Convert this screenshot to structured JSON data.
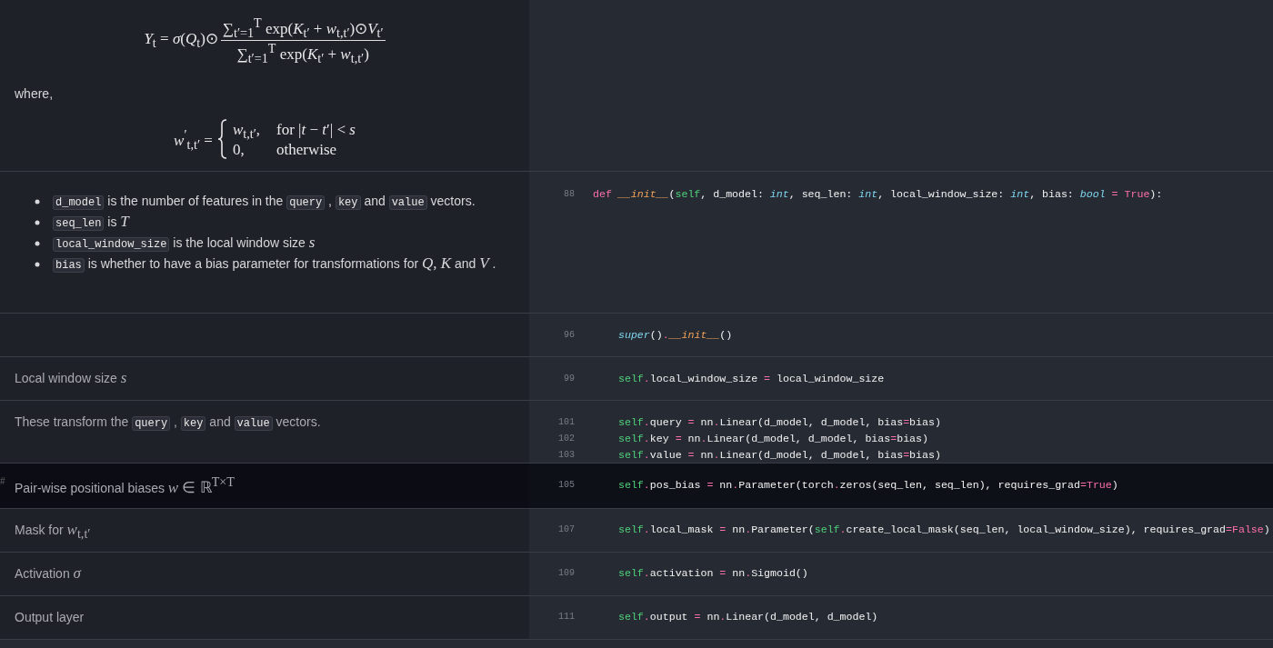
{
  "sections": [
    {
      "selected": false,
      "doc": [
        {
          "kind": "fraction",
          "lhs": "*Y*$_{t}$ = *σ*(*Q*$_{t}$)⊙",
          "numerator": "∑$_{t′=1}$$^{T}$ exp(*K*$_{t′}$ + *w*$_{t,t′}$)⊙*V*$_{t′}$",
          "denominator": "∑$_{t′=1}$$^{T}$ exp(*K*$_{t′}$ + *w*$_{t,t′}$)"
        },
        {
          "kind": "para",
          "segments": [
            {
              "kind": "text",
              "text": "where,"
            }
          ]
        },
        {
          "kind": "cases",
          "lhs": "*w*$^{′}$$_{t,t′}$ =",
          "cases": [
            {
              "value": "*w*$_{t,t′}$,",
              "condition": "for |*t* − *t*′| < *s*"
            },
            {
              "value": "0,",
              "condition": "otherwise"
            }
          ]
        }
      ]
    },
    {
      "selected": false,
      "doc": [
        {
          "kind": "bullets",
          "items": [
            [
              {
                "kind": "code",
                "text": "d_model"
              },
              {
                "kind": "text",
                "text": " is the number of features in the "
              },
              {
                "kind": "code",
                "text": "query"
              },
              {
                "kind": "text",
                "text": " , "
              },
              {
                "kind": "code",
                "text": "key"
              },
              {
                "kind": "text",
                "text": " and "
              },
              {
                "kind": "code",
                "text": "value"
              },
              {
                "kind": "text",
                "text": " vectors."
              }
            ],
            [
              {
                "kind": "code",
                "text": "seq_len"
              },
              {
                "kind": "text",
                "text": " is "
              },
              {
                "kind": "math",
                "text": "*T*"
              }
            ],
            [
              {
                "kind": "code",
                "text": "local_window_size"
              },
              {
                "kind": "text",
                "text": " is the local window size "
              },
              {
                "kind": "math",
                "text": "*s*"
              }
            ],
            [
              {
                "kind": "code",
                "text": "bias"
              },
              {
                "kind": "text",
                "text": " is whether to have a bias parameter for transformations for "
              },
              {
                "kind": "math",
                "text": "*Q*, *K*"
              },
              {
                "kind": "text",
                "text": " and "
              },
              {
                "kind": "math",
                "text": "*V*"
              },
              {
                "kind": "text",
                "text": " ."
              }
            ]
          ]
        }
      ],
      "code": [
        {
          "number": "88",
          "indented": false,
          "tokens": [
            {
              "kind": "kw",
              "text": "def "
            },
            {
              "kind": "fn",
              "text": "__init__"
            },
            {
              "kind": "pl",
              "text": "("
            },
            {
              "kind": "self",
              "text": "self"
            },
            {
              "kind": "pl",
              "text": ", d_model: "
            },
            {
              "kind": "type",
              "text": "int"
            },
            {
              "kind": "pl",
              "text": ", seq_len: "
            },
            {
              "kind": "type",
              "text": "int"
            },
            {
              "kind": "pl",
              "text": ", local_window_size: "
            },
            {
              "kind": "type",
              "text": "int"
            },
            {
              "kind": "pl",
              "text": ", bias: "
            },
            {
              "kind": "type",
              "text": "bool"
            },
            {
              "kind": "op",
              "text": " = "
            },
            {
              "kind": "const",
              "text": "True"
            },
            {
              "kind": "pl",
              "text": "):"
            }
          ]
        }
      ]
    },
    {
      "selected": false,
      "code": [
        {
          "number": "96",
          "indented": true,
          "tokens": [
            {
              "kind": "type",
              "text": "super"
            },
            {
              "kind": "pl",
              "text": "()"
            },
            {
              "kind": "op",
              "text": "."
            },
            {
              "kind": "fn",
              "text": "__init__"
            },
            {
              "kind": "pl",
              "text": "()"
            }
          ]
        }
      ]
    },
    {
      "selected": false,
      "doc": [
        {
          "kind": "para",
          "segments": [
            {
              "kind": "text",
              "text": "Local window size "
            },
            {
              "kind": "math",
              "text": "*s*"
            }
          ]
        }
      ],
      "code": [
        {
          "number": "99",
          "indented": true,
          "tokens": [
            {
              "kind": "self",
              "text": "self"
            },
            {
              "kind": "op",
              "text": "."
            },
            {
              "kind": "pl",
              "text": "local_window_size"
            },
            {
              "kind": "op",
              "text": " = "
            },
            {
              "kind": "pl",
              "text": "local_window_size"
            }
          ]
        }
      ]
    },
    {
      "selected": false,
      "doc": [
        {
          "kind": "para",
          "segments": [
            {
              "kind": "text",
              "text": "These transform the "
            },
            {
              "kind": "code",
              "text": "query"
            },
            {
              "kind": "text",
              "text": " , "
            },
            {
              "kind": "code",
              "text": "key"
            },
            {
              "kind": "text",
              "text": " and "
            },
            {
              "kind": "code",
              "text": "value"
            },
            {
              "kind": "text",
              "text": " vectors."
            }
          ]
        }
      ],
      "code": [
        {
          "number": "101",
          "indented": true,
          "tokens": [
            {
              "kind": "self",
              "text": "self"
            },
            {
              "kind": "op",
              "text": "."
            },
            {
              "kind": "pl",
              "text": "query"
            },
            {
              "kind": "op",
              "text": " = "
            },
            {
              "kind": "pl",
              "text": "nn"
            },
            {
              "kind": "op",
              "text": "."
            },
            {
              "kind": "pl",
              "text": "Linear(d_model, d_model, bias"
            },
            {
              "kind": "op",
              "text": "="
            },
            {
              "kind": "pl",
              "text": "bias)"
            }
          ]
        },
        {
          "number": "102",
          "indented": true,
          "tokens": [
            {
              "kind": "self",
              "text": "self"
            },
            {
              "kind": "op",
              "text": "."
            },
            {
              "kind": "pl",
              "text": "key"
            },
            {
              "kind": "op",
              "text": " = "
            },
            {
              "kind": "pl",
              "text": "nn"
            },
            {
              "kind": "op",
              "text": "."
            },
            {
              "kind": "pl",
              "text": "Linear(d_model, d_model, bias"
            },
            {
              "kind": "op",
              "text": "="
            },
            {
              "kind": "pl",
              "text": "bias)"
            }
          ]
        },
        {
          "number": "103",
          "indented": true,
          "tokens": [
            {
              "kind": "self",
              "text": "self"
            },
            {
              "kind": "op",
              "text": "."
            },
            {
              "kind": "pl",
              "text": "value"
            },
            {
              "kind": "op",
              "text": " = "
            },
            {
              "kind": "pl",
              "text": "nn"
            },
            {
              "kind": "op",
              "text": "."
            },
            {
              "kind": "pl",
              "text": "Linear(d_model, d_model, bias"
            },
            {
              "kind": "op",
              "text": "="
            },
            {
              "kind": "pl",
              "text": "bias)"
            }
          ]
        }
      ]
    },
    {
      "selected": true,
      "anchor": "#",
      "doc": [
        {
          "kind": "para",
          "segments": [
            {
              "kind": "text",
              "text": "Pair-wise positional biases "
            },
            {
              "kind": "math",
              "text": "*w* ∈ ℝ$^{T×T}$"
            }
          ]
        }
      ],
      "code": [
        {
          "number": "105",
          "indented": true,
          "tokens": [
            {
              "kind": "self",
              "text": "self"
            },
            {
              "kind": "op",
              "text": "."
            },
            {
              "kind": "pl",
              "text": "pos_bias"
            },
            {
              "kind": "op",
              "text": " = "
            },
            {
              "kind": "pl",
              "text": "nn"
            },
            {
              "kind": "op",
              "text": "."
            },
            {
              "kind": "pl",
              "text": "Parameter(torch"
            },
            {
              "kind": "op",
              "text": "."
            },
            {
              "kind": "pl",
              "text": "zeros(seq_len, seq_len), requires_grad"
            },
            {
              "kind": "op",
              "text": "="
            },
            {
              "kind": "const",
              "text": "True"
            },
            {
              "kind": "pl",
              "text": ")"
            }
          ]
        }
      ]
    },
    {
      "selected": false,
      "doc": [
        {
          "kind": "para",
          "segments": [
            {
              "kind": "text",
              "text": "Mask for "
            },
            {
              "kind": "math",
              "text": "*w*$_{t,t′}$"
            }
          ]
        }
      ],
      "code": [
        {
          "number": "107",
          "indented": true,
          "tokens": [
            {
              "kind": "self",
              "text": "self"
            },
            {
              "kind": "op",
              "text": "."
            },
            {
              "kind": "pl",
              "text": "local_mask"
            },
            {
              "kind": "op",
              "text": " = "
            },
            {
              "kind": "pl",
              "text": "nn"
            },
            {
              "kind": "op",
              "text": "."
            },
            {
              "kind": "pl",
              "text": "Parameter("
            },
            {
              "kind": "self",
              "text": "self"
            },
            {
              "kind": "op",
              "text": "."
            },
            {
              "kind": "pl",
              "text": "create_local_mask(seq_len, local_window_size), requires_grad"
            },
            {
              "kind": "op",
              "text": "="
            },
            {
              "kind": "const",
              "text": "False"
            },
            {
              "kind": "pl",
              "text": ")"
            }
          ]
        }
      ]
    },
    {
      "selected": false,
      "doc": [
        {
          "kind": "para",
          "segments": [
            {
              "kind": "text",
              "text": "Activation "
            },
            {
              "kind": "math",
              "text": "*σ*"
            }
          ]
        }
      ],
      "code": [
        {
          "number": "109",
          "indented": true,
          "tokens": [
            {
              "kind": "self",
              "text": "self"
            },
            {
              "kind": "op",
              "text": "."
            },
            {
              "kind": "pl",
              "text": "activation"
            },
            {
              "kind": "op",
              "text": " = "
            },
            {
              "kind": "pl",
              "text": "nn"
            },
            {
              "kind": "op",
              "text": "."
            },
            {
              "kind": "pl",
              "text": "Sigmoid()"
            }
          ]
        }
      ]
    },
    {
      "selected": false,
      "doc": [
        {
          "kind": "para",
          "segments": [
            {
              "kind": "text",
              "text": "Output layer"
            }
          ]
        }
      ],
      "code": [
        {
          "number": "111",
          "indented": true,
          "tokens": [
            {
              "kind": "self",
              "text": "self"
            },
            {
              "kind": "op",
              "text": "."
            },
            {
              "kind": "pl",
              "text": "output"
            },
            {
              "kind": "op",
              "text": " = "
            },
            {
              "kind": "pl",
              "text": "nn"
            },
            {
              "kind": "op",
              "text": "."
            },
            {
              "kind": "pl",
              "text": "Linear(d_model, d_model)"
            }
          ]
        }
      ]
    }
  ]
}
